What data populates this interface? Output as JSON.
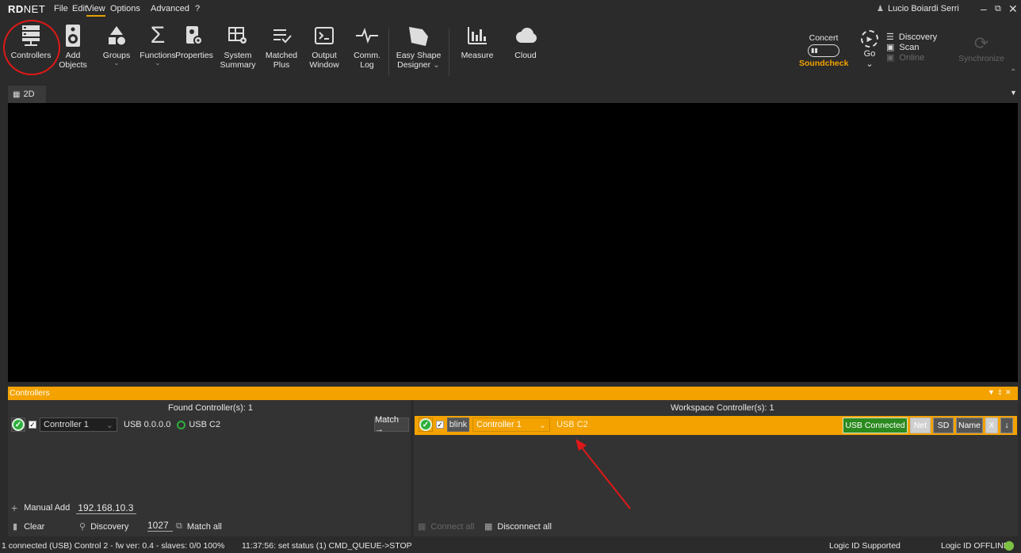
{
  "app": {
    "logo_bold": "RD",
    "logo_light": "NET"
  },
  "menu": {
    "file": "File",
    "edit": "Edit",
    "view": "View",
    "options": "Options",
    "advanced": "Advanced",
    "help": "?"
  },
  "user": {
    "name": "Lucio Boiardi Serri"
  },
  "ribbon": {
    "controllers": "Controllers",
    "add_objects_1": "Add",
    "add_objects_2": "Objects",
    "groups": "Groups",
    "functions": "Functions",
    "properties": "Properties",
    "system_summary_1": "System",
    "system_summary_2": "Summary",
    "matched_plus_1": "Matched",
    "matched_plus_2": "Plus",
    "output_window_1": "Output",
    "output_window_2": "Window",
    "comm_log_1": "Comm.",
    "comm_log_2": "Log",
    "easy_shape_1": "Easy Shape",
    "easy_shape_2": "Designer",
    "measure": "Measure",
    "cloud": "Cloud",
    "concert": "Concert",
    "soundcheck": "Soundcheck",
    "go": "Go",
    "discovery": "Discovery",
    "scan": "Scan",
    "online": "Online",
    "synchronize": "Synchronize"
  },
  "view_tab": {
    "label": "2D"
  },
  "controllers_panel": {
    "title": "Controllers",
    "found_label": "Found Controller(s):  1",
    "workspace_label": "Workspace Controller(s):  1",
    "found_row": {
      "name": "Controller 1",
      "address": "USB 0.0.0.0",
      "conn": "USB C2"
    },
    "match_button": "Match →",
    "workspace_row": {
      "blink": "blink",
      "name": "Controller 1",
      "conn": "USB C2",
      "status": "USB Connected",
      "net": "Net",
      "sd": "SD",
      "name_btn": "Name",
      "x": "X",
      "arrow": "↓"
    },
    "manual_add": "Manual Add",
    "manual_ip": "192.168.10.3",
    "clear": "Clear",
    "discovery": "Discovery",
    "port": "1027",
    "match_all": "Match all",
    "connect_all": "Connect all",
    "disconnect_all": "Disconnect all"
  },
  "status": {
    "left": "1 connected (USB) Control 2 - fw ver: 0.4 - slaves: 0/0 100%",
    "message": "11:37:56: set status (1) CMD_QUEUE->STOP",
    "logic_supported": "Logic ID Supported",
    "logic_offline": "Logic ID  OFFLINE"
  },
  "colors": {
    "accent": "#f3a200",
    "annotation": "#e01818",
    "ok": "#2fae3c",
    "usb_connected_bg": "#2b8a1f"
  }
}
